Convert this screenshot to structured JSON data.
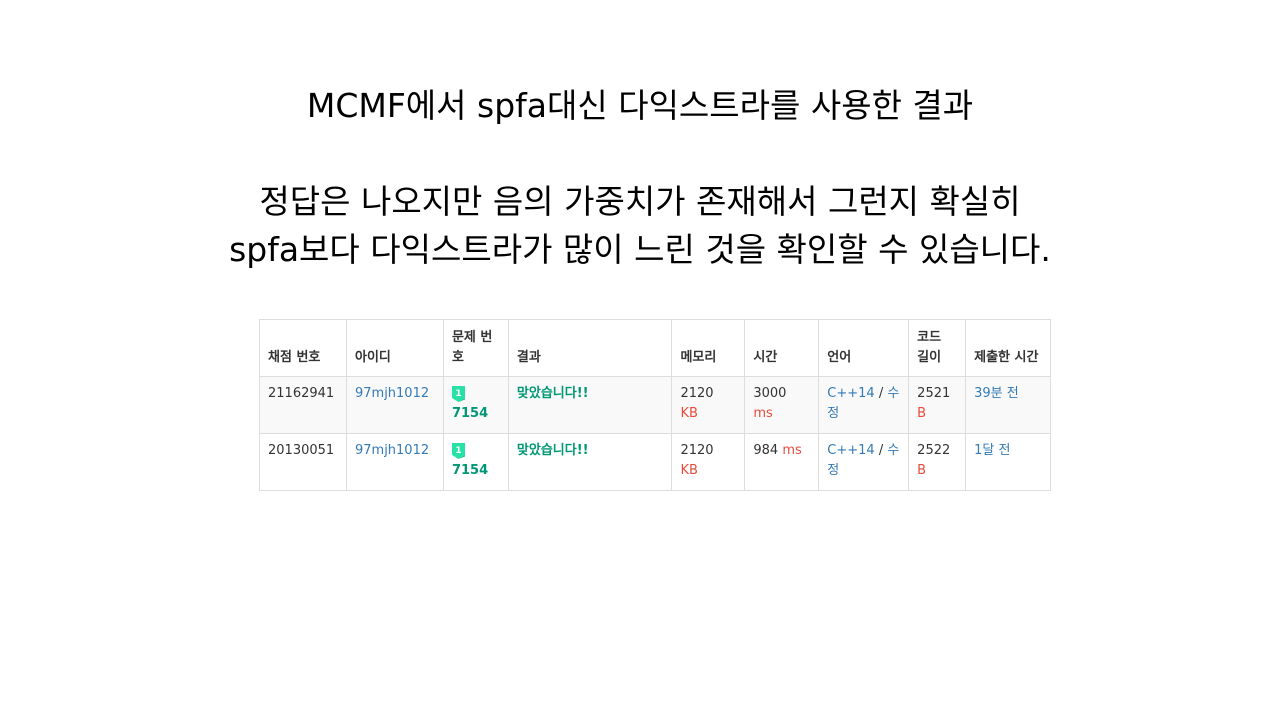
{
  "title": "MCMF에서 spfa대신 다익스트라를 사용한 결과",
  "description": {
    "line1": "정답은 나오지만 음의 가중치가 존재해서 그런지 확실히",
    "line2": "spfa보다 다익스트라가 많이 느린 것을 확인할 수 있습니다."
  },
  "table": {
    "headers": {
      "submission_id": "채점 번호",
      "user_id": "아이디",
      "problem": "문제 번호",
      "result": "결과",
      "memory": "메모리",
      "time": "시간",
      "language": "언어",
      "code_length": "코드 길이",
      "submitted_at": "제출한 시간"
    },
    "rows": [
      {
        "submission_id": "21162941",
        "user_id": "97mjh1012",
        "problem_tier": "1",
        "problem_id": "7154",
        "result": "맞았습니다!!",
        "memory_value": "2120",
        "memory_unit": "KB",
        "time_value": "3000",
        "time_unit": "ms",
        "language": "C++14",
        "language_sep": "/",
        "edit_label": "수정",
        "code_value": "2521",
        "code_unit": "B",
        "submitted_at": "39분 전"
      },
      {
        "submission_id": "20130051",
        "user_id": "97mjh1012",
        "problem_tier": "1",
        "problem_id": "7154",
        "result": "맞았습니다!!",
        "memory_value": "2120",
        "memory_unit": "KB",
        "time_value": "984",
        "time_unit": "ms",
        "language": "C++14",
        "language_sep": "/",
        "edit_label": "수정",
        "code_value": "2522",
        "code_unit": "B",
        "submitted_at": "1달 전"
      }
    ]
  },
  "colors": {
    "link": "#337ab7",
    "accepted": "#009874",
    "unit": "#e74c3c",
    "tier_badge": "#27e2a4"
  },
  "icons": {
    "tier_badge": "ruby-tier-1-icon"
  }
}
